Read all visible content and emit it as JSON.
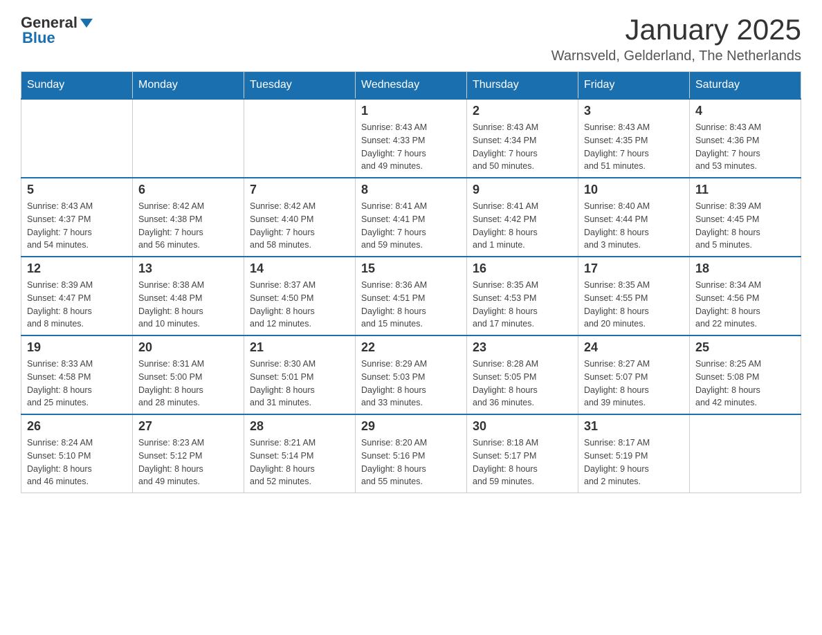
{
  "header": {
    "logo_general": "General",
    "logo_blue": "Blue",
    "month_title": "January 2025",
    "location": "Warnsveld, Gelderland, The Netherlands"
  },
  "weekdays": [
    "Sunday",
    "Monday",
    "Tuesday",
    "Wednesday",
    "Thursday",
    "Friday",
    "Saturday"
  ],
  "weeks": [
    [
      {
        "day": "",
        "info": ""
      },
      {
        "day": "",
        "info": ""
      },
      {
        "day": "",
        "info": ""
      },
      {
        "day": "1",
        "info": "Sunrise: 8:43 AM\nSunset: 4:33 PM\nDaylight: 7 hours\nand 49 minutes."
      },
      {
        "day": "2",
        "info": "Sunrise: 8:43 AM\nSunset: 4:34 PM\nDaylight: 7 hours\nand 50 minutes."
      },
      {
        "day": "3",
        "info": "Sunrise: 8:43 AM\nSunset: 4:35 PM\nDaylight: 7 hours\nand 51 minutes."
      },
      {
        "day": "4",
        "info": "Sunrise: 8:43 AM\nSunset: 4:36 PM\nDaylight: 7 hours\nand 53 minutes."
      }
    ],
    [
      {
        "day": "5",
        "info": "Sunrise: 8:43 AM\nSunset: 4:37 PM\nDaylight: 7 hours\nand 54 minutes."
      },
      {
        "day": "6",
        "info": "Sunrise: 8:42 AM\nSunset: 4:38 PM\nDaylight: 7 hours\nand 56 minutes."
      },
      {
        "day": "7",
        "info": "Sunrise: 8:42 AM\nSunset: 4:40 PM\nDaylight: 7 hours\nand 58 minutes."
      },
      {
        "day": "8",
        "info": "Sunrise: 8:41 AM\nSunset: 4:41 PM\nDaylight: 7 hours\nand 59 minutes."
      },
      {
        "day": "9",
        "info": "Sunrise: 8:41 AM\nSunset: 4:42 PM\nDaylight: 8 hours\nand 1 minute."
      },
      {
        "day": "10",
        "info": "Sunrise: 8:40 AM\nSunset: 4:44 PM\nDaylight: 8 hours\nand 3 minutes."
      },
      {
        "day": "11",
        "info": "Sunrise: 8:39 AM\nSunset: 4:45 PM\nDaylight: 8 hours\nand 5 minutes."
      }
    ],
    [
      {
        "day": "12",
        "info": "Sunrise: 8:39 AM\nSunset: 4:47 PM\nDaylight: 8 hours\nand 8 minutes."
      },
      {
        "day": "13",
        "info": "Sunrise: 8:38 AM\nSunset: 4:48 PM\nDaylight: 8 hours\nand 10 minutes."
      },
      {
        "day": "14",
        "info": "Sunrise: 8:37 AM\nSunset: 4:50 PM\nDaylight: 8 hours\nand 12 minutes."
      },
      {
        "day": "15",
        "info": "Sunrise: 8:36 AM\nSunset: 4:51 PM\nDaylight: 8 hours\nand 15 minutes."
      },
      {
        "day": "16",
        "info": "Sunrise: 8:35 AM\nSunset: 4:53 PM\nDaylight: 8 hours\nand 17 minutes."
      },
      {
        "day": "17",
        "info": "Sunrise: 8:35 AM\nSunset: 4:55 PM\nDaylight: 8 hours\nand 20 minutes."
      },
      {
        "day": "18",
        "info": "Sunrise: 8:34 AM\nSunset: 4:56 PM\nDaylight: 8 hours\nand 22 minutes."
      }
    ],
    [
      {
        "day": "19",
        "info": "Sunrise: 8:33 AM\nSunset: 4:58 PM\nDaylight: 8 hours\nand 25 minutes."
      },
      {
        "day": "20",
        "info": "Sunrise: 8:31 AM\nSunset: 5:00 PM\nDaylight: 8 hours\nand 28 minutes."
      },
      {
        "day": "21",
        "info": "Sunrise: 8:30 AM\nSunset: 5:01 PM\nDaylight: 8 hours\nand 31 minutes."
      },
      {
        "day": "22",
        "info": "Sunrise: 8:29 AM\nSunset: 5:03 PM\nDaylight: 8 hours\nand 33 minutes."
      },
      {
        "day": "23",
        "info": "Sunrise: 8:28 AM\nSunset: 5:05 PM\nDaylight: 8 hours\nand 36 minutes."
      },
      {
        "day": "24",
        "info": "Sunrise: 8:27 AM\nSunset: 5:07 PM\nDaylight: 8 hours\nand 39 minutes."
      },
      {
        "day": "25",
        "info": "Sunrise: 8:25 AM\nSunset: 5:08 PM\nDaylight: 8 hours\nand 42 minutes."
      }
    ],
    [
      {
        "day": "26",
        "info": "Sunrise: 8:24 AM\nSunset: 5:10 PM\nDaylight: 8 hours\nand 46 minutes."
      },
      {
        "day": "27",
        "info": "Sunrise: 8:23 AM\nSunset: 5:12 PM\nDaylight: 8 hours\nand 49 minutes."
      },
      {
        "day": "28",
        "info": "Sunrise: 8:21 AM\nSunset: 5:14 PM\nDaylight: 8 hours\nand 52 minutes."
      },
      {
        "day": "29",
        "info": "Sunrise: 8:20 AM\nSunset: 5:16 PM\nDaylight: 8 hours\nand 55 minutes."
      },
      {
        "day": "30",
        "info": "Sunrise: 8:18 AM\nSunset: 5:17 PM\nDaylight: 8 hours\nand 59 minutes."
      },
      {
        "day": "31",
        "info": "Sunrise: 8:17 AM\nSunset: 5:19 PM\nDaylight: 9 hours\nand 2 minutes."
      },
      {
        "day": "",
        "info": ""
      }
    ]
  ]
}
